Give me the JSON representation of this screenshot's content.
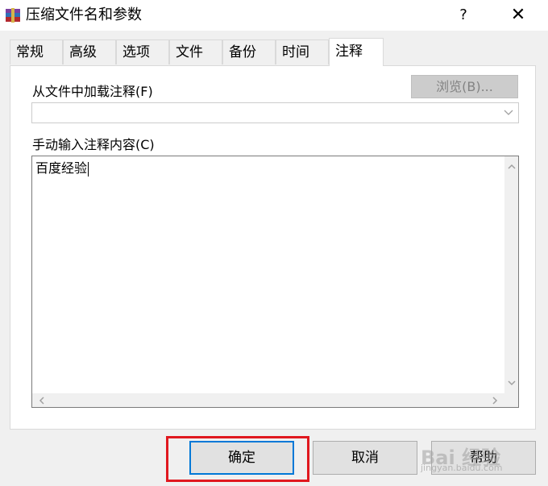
{
  "window": {
    "title": "压缩文件名和参数",
    "help_glyph": "?",
    "close_glyph": "✕",
    "app_icon": "winrar-books-icon"
  },
  "tabs": [
    {
      "label": "常规",
      "active": false
    },
    {
      "label": "高级",
      "active": false
    },
    {
      "label": "选项",
      "active": false
    },
    {
      "label": "文件",
      "active": false
    },
    {
      "label": "备份",
      "active": false
    },
    {
      "label": "时间",
      "active": false
    },
    {
      "label": "注释",
      "active": true
    }
  ],
  "comment_tab": {
    "load_from_file_label": "从文件中加载注释(F)",
    "browse_button": "浏览(B)...",
    "browse_enabled": false,
    "file_combo_value": "",
    "manual_input_label": "手动输入注释内容(C)",
    "comment_text": "百度经验"
  },
  "buttons": {
    "ok": "确定",
    "cancel": "取消",
    "help": "帮助"
  },
  "annotation": {
    "highlight_color": "#e0181f",
    "highlighted": "ok"
  },
  "watermark": {
    "logo": "Bai 经验",
    "url": "jingyan.baidu.com"
  },
  "colors": {
    "accent": "#0078d7",
    "dialog_bg": "#f0f0f0"
  }
}
